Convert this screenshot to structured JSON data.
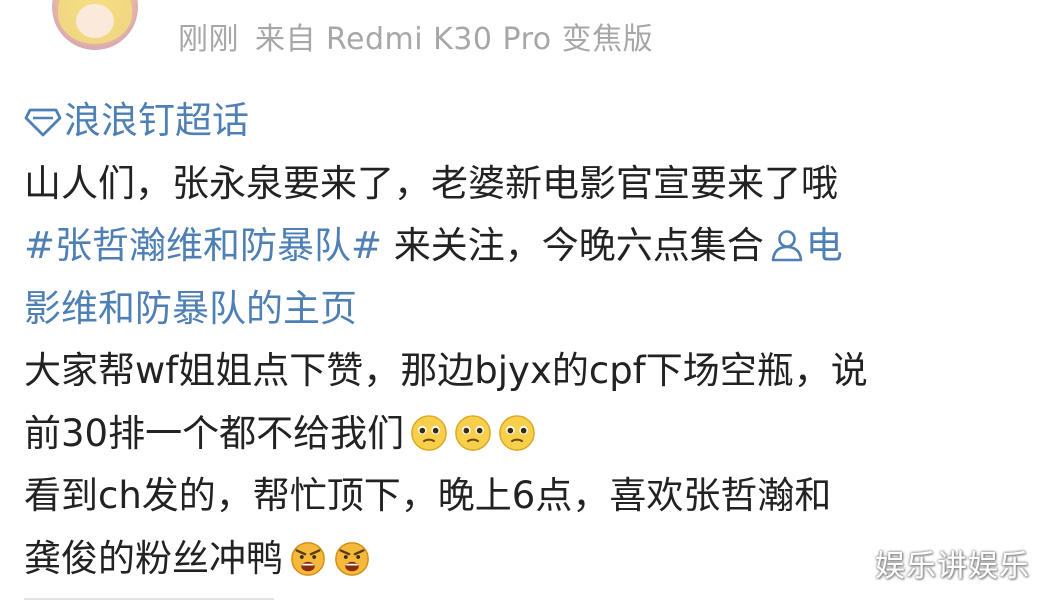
{
  "header": {
    "time": "刚刚",
    "source": "来自 Redmi K30 Pro 变焦版"
  },
  "post": {
    "supertopic": {
      "icon": "diamond-icon",
      "label": "浪浪钉超话"
    },
    "line1": "山人们，张永泉要来了，老婆新电影官宣要来了哦",
    "hashtag": "#张哲瀚维和防暴队#",
    "line2_text": " 来关注，今晚六点集合",
    "user_link": {
      "icon": "user-icon",
      "label_part1": "电",
      "label_part2": "影维和防暴队的主页"
    },
    "line4": "大家帮wf姐姐点下赞，那边bjyx的cpf下场空瓶，说",
    "line5": "前30排一个都不给我们",
    "line6": "看到ch发的，帮忙顶下，晚上6点，喜欢张哲瀚和",
    "line7": "龚俊的粉丝冲鸭",
    "emoji_sad": "pleading-face-emoji",
    "emoji_angry": "angry-shouting-emoji"
  },
  "watermark": "娱乐讲娱乐",
  "colors": {
    "link": "#4e7fb5",
    "text": "#222222",
    "meta": "#a7a7a7"
  }
}
